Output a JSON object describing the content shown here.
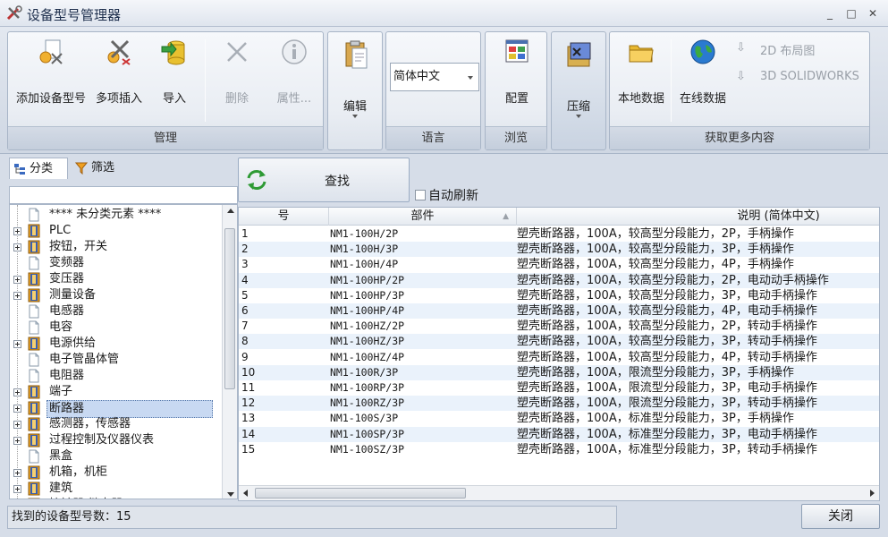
{
  "window": {
    "title": "设备型号管理器",
    "minimize": "_",
    "maximize": "□",
    "close": "✕"
  },
  "ribbon": {
    "manage": {
      "label": "管理",
      "add": "添加设备型号",
      "multi_insert": "多项插入",
      "import": "导入",
      "delete": "删除",
      "properties": "属性..."
    },
    "edit": {
      "label": "编辑"
    },
    "language": {
      "label": "语言",
      "selected": "简体中文"
    },
    "browse": {
      "label": "浏览",
      "config": "配置"
    },
    "compress": {
      "label": "压缩"
    },
    "more": {
      "label": "获取更多内容",
      "local": "本地数据",
      "online": "在线数据",
      "layout2d": "2D 布局图",
      "solidworks": "3D SOLIDWORKS"
    }
  },
  "left": {
    "tabs": {
      "classify": "分类",
      "filter": "筛选"
    },
    "tree": [
      {
        "label": "**** 未分类元素 ****",
        "expandable": false,
        "icon": "doc"
      },
      {
        "label": "PLC",
        "expandable": true,
        "icon": "book"
      },
      {
        "label": "按钮，开关",
        "expandable": true,
        "icon": "book"
      },
      {
        "label": "变频器",
        "expandable": false,
        "icon": "doc"
      },
      {
        "label": "变压器",
        "expandable": true,
        "icon": "book"
      },
      {
        "label": "测量设备",
        "expandable": true,
        "icon": "book"
      },
      {
        "label": "电感器",
        "expandable": false,
        "icon": "doc"
      },
      {
        "label": "电容",
        "expandable": false,
        "icon": "doc"
      },
      {
        "label": "电源供给",
        "expandable": true,
        "icon": "book"
      },
      {
        "label": "电子管晶体管",
        "expandable": false,
        "icon": "doc"
      },
      {
        "label": "电阻器",
        "expandable": false,
        "icon": "doc"
      },
      {
        "label": "端子",
        "expandable": true,
        "icon": "book"
      },
      {
        "label": "断路器",
        "expandable": true,
        "icon": "book",
        "selected": true
      },
      {
        "label": "感测器，传感器",
        "expandable": true,
        "icon": "book"
      },
      {
        "label": "过程控制及仪器仪表",
        "expandable": true,
        "icon": "book"
      },
      {
        "label": "黑盒",
        "expandable": false,
        "icon": "doc"
      },
      {
        "label": "机箱，机柜",
        "expandable": true,
        "icon": "book"
      },
      {
        "label": "建筑",
        "expandable": true,
        "icon": "book"
      },
      {
        "label": "接触器 继电器",
        "expandable": true,
        "icon": "book"
      }
    ]
  },
  "right": {
    "search_label": "查找",
    "auto_refresh": "自动刷新",
    "columns": {
      "num": "号",
      "part": "部件",
      "desc": "说明 (简体中文)"
    },
    "rows": [
      {
        "n": "1",
        "part": "NM1-100H/2P",
        "desc": "塑壳断路器，100A，较高型分段能力，2P，手柄操作"
      },
      {
        "n": "2",
        "part": "NM1-100H/3P",
        "desc": "塑壳断路器，100A，较高型分段能力，3P，手柄操作"
      },
      {
        "n": "3",
        "part": "NM1-100H/4P",
        "desc": "塑壳断路器，100A，较高型分段能力，4P，手柄操作"
      },
      {
        "n": "4",
        "part": "NM1-100HP/2P",
        "desc": "塑壳断路器，100A，较高型分段能力，2P，电动动手柄操作"
      },
      {
        "n": "5",
        "part": "NM1-100HP/3P",
        "desc": "塑壳断路器，100A，较高型分段能力，3P，电动手柄操作"
      },
      {
        "n": "6",
        "part": "NM1-100HP/4P",
        "desc": "塑壳断路器，100A，较高型分段能力，4P，电动手柄操作"
      },
      {
        "n": "7",
        "part": "NM1-100HZ/2P",
        "desc": "塑壳断路器，100A，较高型分段能力，2P，转动手柄操作"
      },
      {
        "n": "8",
        "part": "NM1-100HZ/3P",
        "desc": "塑壳断路器，100A，较高型分段能力，3P，转动手柄操作"
      },
      {
        "n": "9",
        "part": "NM1-100HZ/4P",
        "desc": "塑壳断路器，100A，较高型分段能力，4P，转动手柄操作"
      },
      {
        "n": "10",
        "part": "NM1-100R/3P",
        "desc": "塑壳断路器，100A，限流型分段能力，3P，手柄操作"
      },
      {
        "n": "11",
        "part": "NM1-100RP/3P",
        "desc": "塑壳断路器，100A，限流型分段能力，3P，电动手柄操作"
      },
      {
        "n": "12",
        "part": "NM1-100RZ/3P",
        "desc": "塑壳断路器，100A，限流型分段能力，3P，转动手柄操作"
      },
      {
        "n": "13",
        "part": "NM1-100S/3P",
        "desc": "塑壳断路器，100A，标准型分段能力，3P，手柄操作"
      },
      {
        "n": "14",
        "part": "NM1-100SP/3P",
        "desc": "塑壳断路器，100A，标准型分段能力，3P，电动手柄操作"
      },
      {
        "n": "15",
        "part": "NM1-100SZ/3P",
        "desc": "塑壳断路器，100A，标准型分段能力，3P，转动手柄操作"
      }
    ]
  },
  "status": {
    "found": "找到的设备型号数：15"
  },
  "close_label": "关闭"
}
